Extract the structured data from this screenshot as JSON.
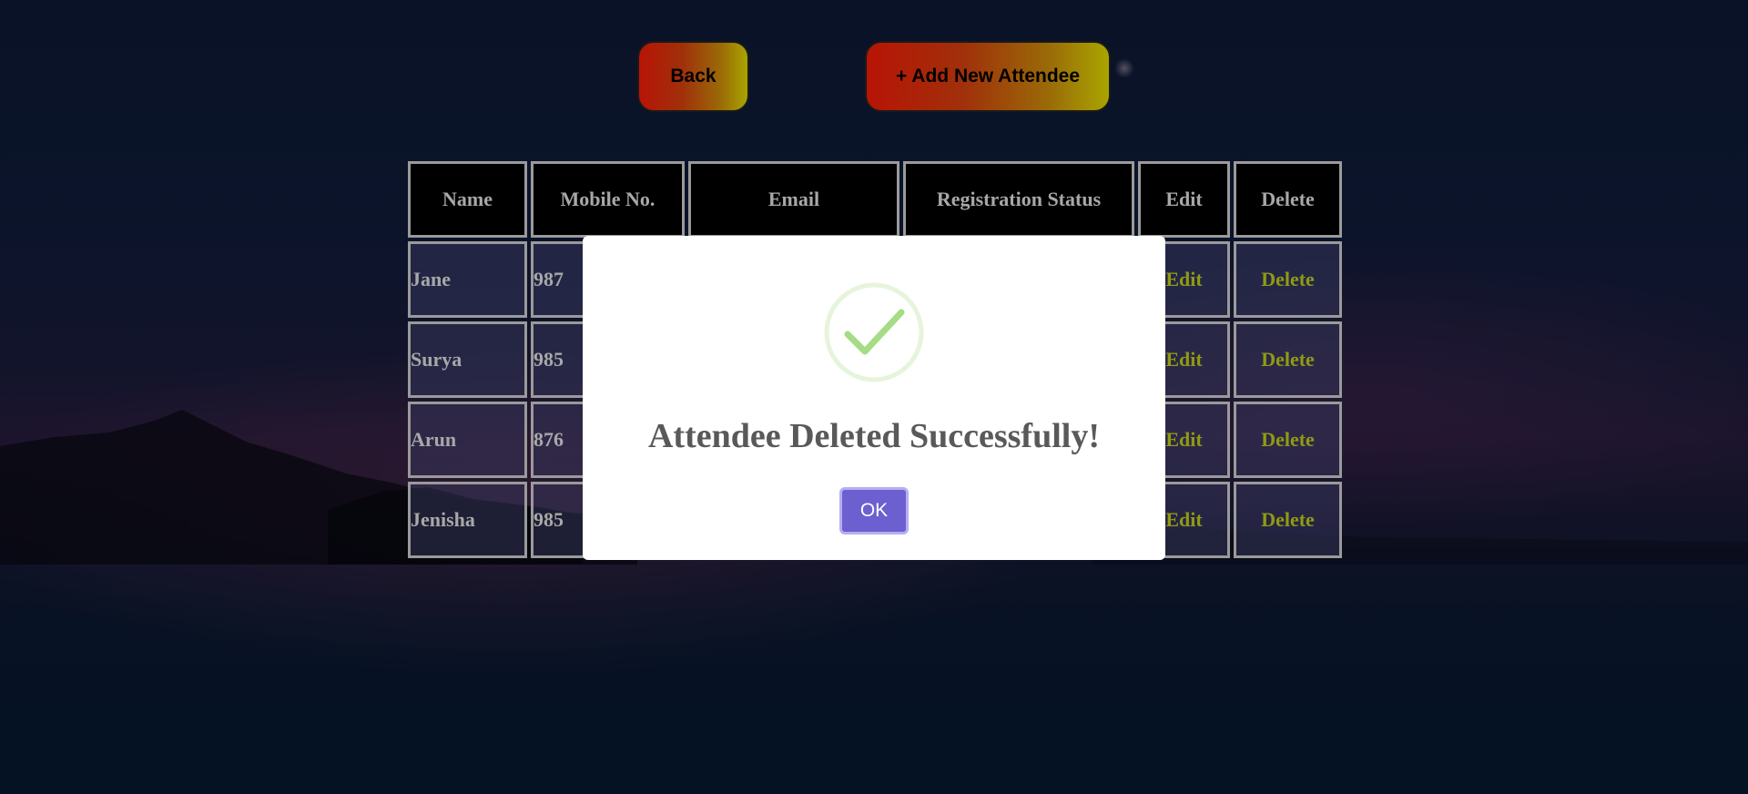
{
  "header": {
    "back_label": "Back",
    "add_label": "+ Add New Attendee"
  },
  "table": {
    "columns": [
      "Name",
      "Mobile No.",
      "Email",
      "Registration Status",
      "Edit",
      "Delete"
    ],
    "rows": [
      {
        "name": "Jane",
        "mobile": "987",
        "edit": "Edit",
        "delete": "Delete"
      },
      {
        "name": "Surya",
        "mobile": "985",
        "edit": "Edit",
        "delete": "Delete"
      },
      {
        "name": "Arun",
        "mobile": "876",
        "edit": "Edit",
        "delete": "Delete"
      },
      {
        "name": "Jenisha",
        "mobile": "985",
        "edit": "Edit",
        "delete": "Delete"
      }
    ]
  },
  "modal": {
    "icon": "success-check-icon",
    "title": "Attendee Deleted Successfully!",
    "ok_label": "OK"
  },
  "colors": {
    "button_gradient_start": "#b81406",
    "button_gradient_end": "#a9a500",
    "action_link": "#8f9a14",
    "ok_button": "#6c5fd0",
    "check_green": "#a5dc86"
  }
}
